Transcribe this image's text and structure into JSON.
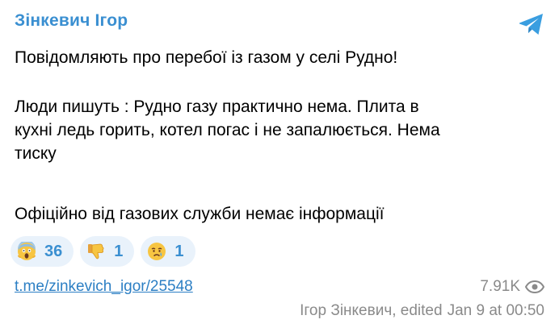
{
  "channel": {
    "title": "Зінкевич Ігор",
    "logo_icon": "telegram-icon"
  },
  "message": {
    "line1": "Повідомляють про перебої із газом у селі Рудно!",
    "line2": "Люди пишуть : Рудно газу практично нема. Плита в\nкухні ледь горить, котел погас і не запалюється. Нема\nтиску",
    "line3": "Офіційно від газових служби немає інформації"
  },
  "reactions": [
    {
      "icon": "screaming-face-emoji",
      "count": "36"
    },
    {
      "icon": "thumbs-down-emoji",
      "count": "1"
    },
    {
      "icon": "crying-face-emoji",
      "count": "1"
    }
  ],
  "footer": {
    "link": "t.me/zinkevich_igor/25548",
    "views": "7.91K",
    "views_icon": "eye-icon",
    "author_edited": "Ігор Зінкевич, edited",
    "date": "Jan 9 at 00:50"
  },
  "colors": {
    "accent": "#3a8fd1",
    "reaction_bg": "#e9f2fb",
    "meta_text": "#8a8a8a"
  }
}
